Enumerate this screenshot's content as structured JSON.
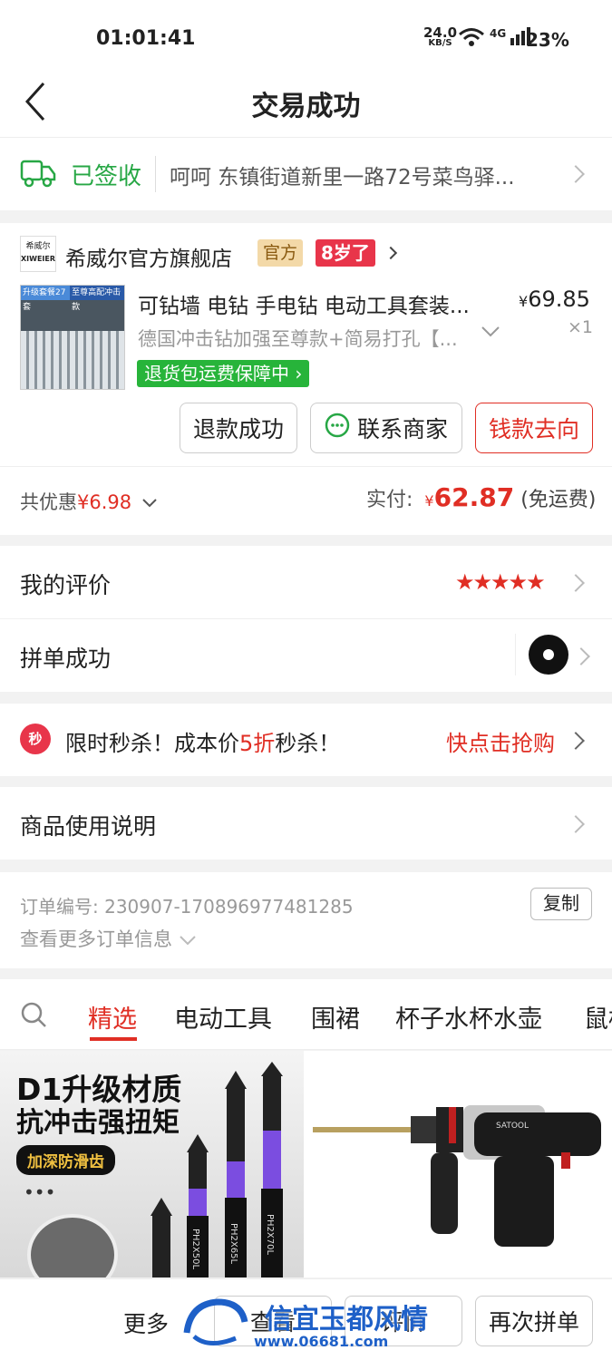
{
  "status_bar": {
    "time": "01:01:41",
    "net_speed_top": "24.0",
    "net_speed_bottom": "KB/S",
    "signal": "4G",
    "battery": "23%"
  },
  "header": {
    "title": "交易成功"
  },
  "delivery": {
    "status": "已签收",
    "address": "呵呵 东镇街道新里一路72号菜鸟驿..."
  },
  "shop": {
    "logo_top": "希威尔",
    "logo_bottom": "XIWEIER",
    "name": "希威尔官方旗舰店",
    "official_badge": "官方",
    "age_badge": "8岁了"
  },
  "product": {
    "thumb_banner_left": "升级套餐27套",
    "thumb_banner_right": "至尊高配冲击款",
    "title": "可钻墙 电钻 手电钻 电动工具套装...",
    "spec": "德国冲击钻加强至尊款+简易打孔【...",
    "price_symbol": "¥",
    "price": "69.85",
    "qty": "×1",
    "guarantee": "退货包运费保障中"
  },
  "actions": {
    "refund": "退款成功",
    "contact": "联系商家",
    "money_flow": "钱款去向"
  },
  "summary": {
    "discount_label": "共优惠",
    "discount_value": "¥6.98",
    "paid_label": "实付:",
    "paid_symbol": "¥",
    "paid_value": "62.87",
    "shipping": "(免运费)"
  },
  "review": {
    "label": "我的评价",
    "stars": 5
  },
  "group": {
    "label": "拼单成功"
  },
  "flash_sale": {
    "icon_text": "秒",
    "text_before": "限时秒杀！成本价",
    "highlight": "5折",
    "text_after": "秒杀！",
    "cta": "快点击抢购"
  },
  "instructions": {
    "label": "商品使用说明"
  },
  "order": {
    "number_label": "订单编号:",
    "number": "230907-170896977481285",
    "copy": "复制",
    "more": "查看更多订单信息"
  },
  "category_tabs": [
    "精选",
    "电动工具",
    "围裙",
    "杯子水杯水壶",
    "鼠标"
  ],
  "rec_left": {
    "line1": "D1升级材质",
    "line2": "抗冲击强扭矩",
    "tag": "加深防滑齿",
    "bit_labels": [
      "PH2X50L",
      "PH2X65L",
      "PH2X70L"
    ]
  },
  "rec_right": {
    "brand": "SATOOL"
  },
  "bottom_bar": {
    "more": "更多",
    "btn_middle": "查看",
    "btn_review": "评价",
    "btn_rebuy": "再次拼单"
  },
  "watermark": {
    "line1": "信宜玉都风情",
    "line2": "www.06681.com"
  }
}
